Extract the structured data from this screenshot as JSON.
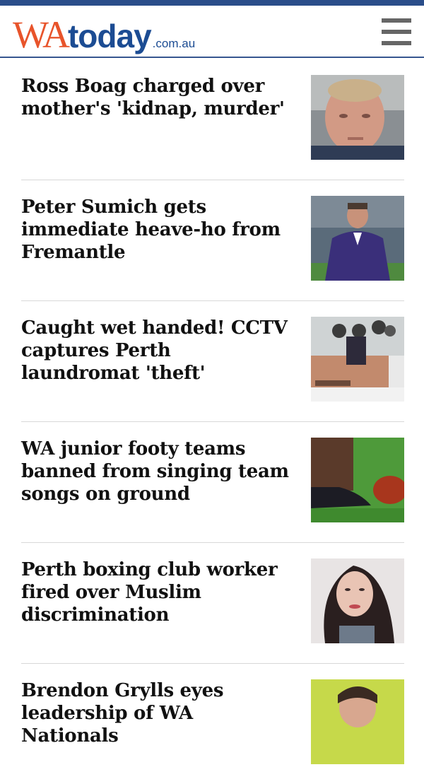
{
  "header": {
    "logo": {
      "wa": "WA",
      "today": "today",
      "tld": ".com.au"
    },
    "menu_icon": "hamburger-menu-icon"
  },
  "articles": [
    {
      "headline": "Ross Boag charged over mother's 'kidnap, murder'",
      "thumbnail": "man-selfie-photo"
    },
    {
      "headline": "Peter Sumich gets immediate heave-ho from Fremantle",
      "thumbnail": "coach-on-field-photo"
    },
    {
      "headline": "Caught wet handed! CCTV captures Perth laundromat 'theft'",
      "thumbnail": "cctv-laundromat-photo"
    },
    {
      "headline": "WA junior footy teams banned from singing team songs on ground",
      "thumbnail": "football-boot-photo"
    },
    {
      "headline": "Perth boxing club worker fired over Muslim discrimination",
      "thumbnail": "woman-portrait-photo"
    },
    {
      "headline": "Brendon Grylls eyes leadership of WA Nationals",
      "thumbnail": "politician-photo"
    }
  ],
  "colors": {
    "brand_orange": "#e8542b",
    "brand_blue": "#1c4c93",
    "rule": "#36568f"
  }
}
